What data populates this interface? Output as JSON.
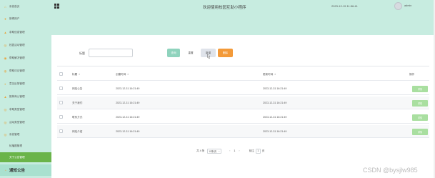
{
  "colors": {
    "sidebar_bg": "#c7ece0",
    "header_bg": "#c7ece0",
    "active_item": "#6ab44a",
    "search_button": "#8fd3bd",
    "delete_button": "#f39a39",
    "detail_button": "#a9dfa0"
  },
  "sidebar": {
    "items": [
      {
        "label": "系统首页",
        "icon": "home-icon"
      },
      {
        "label": "新闻用户",
        "icon": "user-icon"
      },
      {
        "label": "求助信息管理",
        "icon": "help-icon"
      },
      {
        "label": "校园活动管理",
        "icon": "activity-icon"
      },
      {
        "label": "帮助解决管理",
        "icon": "handshake-icon"
      },
      {
        "label": "帮助评论管理",
        "icon": "comment-icon"
      },
      {
        "label": "意见反馈管理",
        "icon": "feedback-icon"
      },
      {
        "label": "推荐商公管理",
        "icon": "recommend-icon"
      },
      {
        "label": "求助类型管理",
        "icon": "category-icon"
      },
      {
        "label": "活动类型管理",
        "icon": "tag-icon"
      },
      {
        "label": "系统管理",
        "icon": "settings-icon"
      },
      {
        "label": "轮播图管理",
        "icon": "image-icon"
      },
      {
        "label": "关于公告管理",
        "icon": "info-icon"
      }
    ],
    "bottom_item": {
      "label": "通知公告",
      "icon": "bell-icon"
    }
  },
  "header": {
    "title": "欢迎使用校园互助小程序",
    "datetime": "2023-12-15 11:56:41",
    "username": "admin"
  },
  "search": {
    "label": "标题",
    "placeholder": "",
    "search_label": "查询",
    "reset_label": "重置",
    "add_label": "新增",
    "delete_label": "删除"
  },
  "table": {
    "columns": [
      "标题",
      "创建时间",
      "更新时间",
      "操作"
    ],
    "rows": [
      {
        "title": "网站公告",
        "created": "2023-12-31 16:21:49",
        "updated": "2023-12-31 16:21:49",
        "action": "详情"
      },
      {
        "title": "关于我们",
        "created": "2023-12-31 16:21:49",
        "updated": "2023-12-31 16:21:49",
        "action": "详情"
      },
      {
        "title": "联系方式",
        "created": "2023-12-31 16:21:49",
        "updated": "2023-12-31 16:21:49",
        "action": "详情"
      },
      {
        "title": "网站介绍",
        "created": "2023-12-31 16:21:49",
        "updated": "2023-12-31 16:21:49",
        "action": "详情"
      }
    ]
  },
  "pagination": {
    "total": "共 4 条",
    "page_size": "10条/页",
    "current_page": "1",
    "goto_prefix": "前往",
    "goto_value": "1",
    "goto_suffix": "页"
  },
  "watermark": "CSDN @bysjlw985"
}
